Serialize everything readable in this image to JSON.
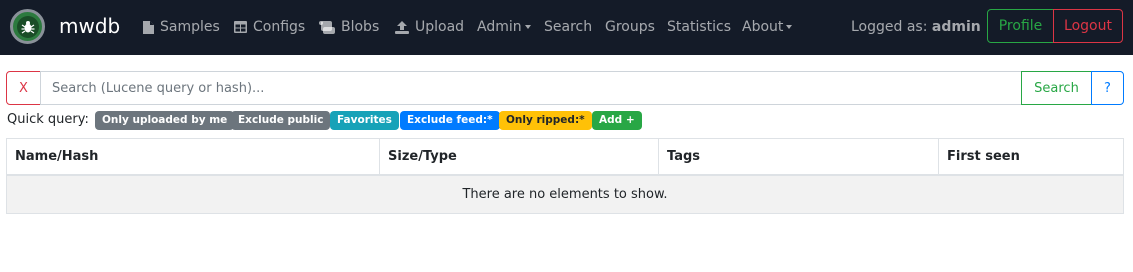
{
  "navbar": {
    "brand": "mwdb",
    "items": [
      {
        "label": "Samples",
        "icon": "file-icon"
      },
      {
        "label": "Configs",
        "icon": "table-icon"
      },
      {
        "label": "Blobs",
        "icon": "scroll-icon"
      },
      {
        "label": "Upload",
        "icon": "upload-icon"
      },
      {
        "label": "Admin",
        "dropdown": true
      },
      {
        "label": "Search"
      },
      {
        "label": "Groups"
      },
      {
        "label": "Statistics"
      },
      {
        "label": "About",
        "dropdown": true
      }
    ],
    "logged_prefix": "Logged as:",
    "username": "admin",
    "profile_label": "Profile",
    "logout_label": "Logout"
  },
  "search": {
    "clear_label": "X",
    "placeholder": "Search (Lucene query or hash)...",
    "value": "",
    "submit_label": "Search",
    "help_label": "?"
  },
  "quick_query": {
    "label": "Quick query:",
    "badges": [
      {
        "label": "Only uploaded by me",
        "color": "#6c757d"
      },
      {
        "label": "Exclude public",
        "color": "#6c757d"
      },
      {
        "label": "Favorites",
        "color": "#17a2b8"
      },
      {
        "label": "Exclude feed:*",
        "color": "#007bff"
      },
      {
        "label": "Only ripped:*",
        "color": "#ffc107"
      },
      {
        "label": "Add +",
        "color": "#28a745"
      }
    ]
  },
  "table": {
    "columns": [
      "Name/Hash",
      "Size/Type",
      "Tags",
      "First seen"
    ],
    "empty_message": "There are no elements to show."
  },
  "colors": {
    "navbar_bg": "#141b28",
    "success": "#28a745",
    "danger": "#dc3545",
    "primary": "#007bff"
  }
}
